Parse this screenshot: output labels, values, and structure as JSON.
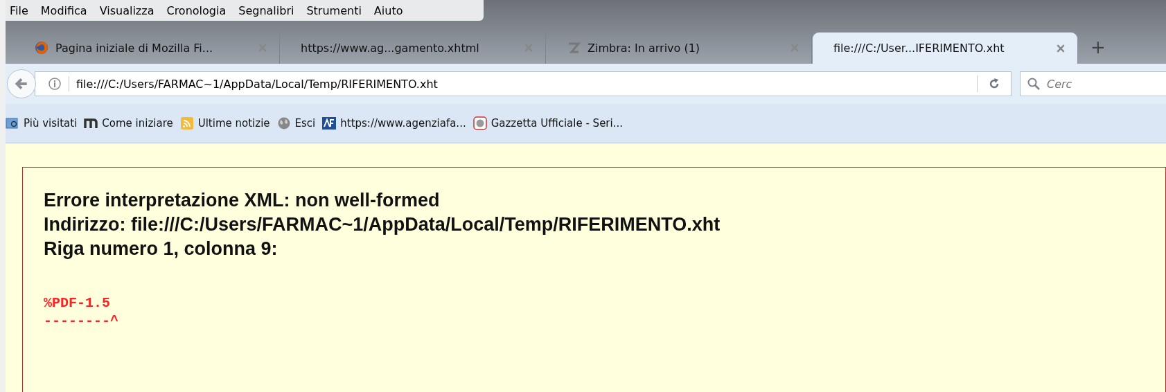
{
  "menu_bar": [
    "File",
    "Modifica",
    "Visualizza",
    "Cronologia",
    "Segnalibri",
    "Strumenti",
    "Aiuto"
  ],
  "tabs": [
    {
      "label": "Pagina iniziale di Mozilla Fi...",
      "selected": false
    },
    {
      "label": "https://www.ag...gamento.xhtml",
      "selected": false
    },
    {
      "label": "Zimbra: In arrivo (1)",
      "selected": false
    },
    {
      "label": "file:///C:/User...IFERIMENTO.xht",
      "selected": true
    }
  ],
  "new_tab": "+",
  "address_bar": {
    "value": "file:///C:/Users/FARMAC~1/AppData/Local/Temp/RIFERIMENTO.xht"
  },
  "search": {
    "placeholder": "Cerc"
  },
  "bookmarks": [
    {
      "label": "Più visitati"
    },
    {
      "label": "Come iniziare"
    },
    {
      "label": "Ultime notizie"
    },
    {
      "label": "Esci"
    },
    {
      "label": "https://www.agenziafa..."
    },
    {
      "label": "Gazzetta Ufficiale - Seri..."
    }
  ],
  "error": {
    "lines": [
      "Errore interpretazione XML: non well-formed",
      "Indirizzo: file:///C:/Users/FARMAC~1/AppData/Local/Temp/RIFERIMENTO.xht",
      "Riga numero 1, colonna 9:"
    ],
    "source": [
      "%PDF-1.5",
      "--------^"
    ]
  }
}
